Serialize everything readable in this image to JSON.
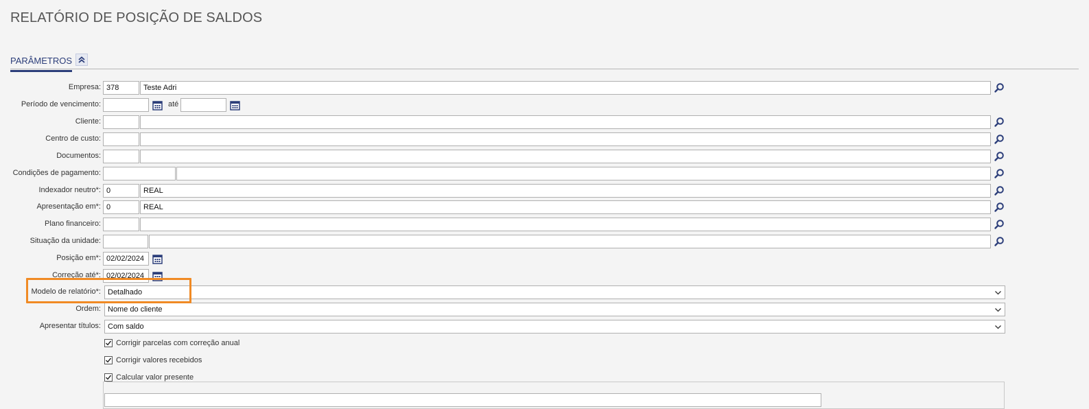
{
  "page": {
    "title": "RELATÓRIO DE POSIÇÃO DE SALDOS"
  },
  "section": {
    "title": "PARÂMETROS"
  },
  "fields": {
    "empresa": {
      "label": "Empresa:",
      "code": "378",
      "name": "Teste Adri"
    },
    "periodo": {
      "label": "Período de vencimento:",
      "from": "",
      "to": "",
      "ate_label": "até"
    },
    "cliente": {
      "label": "Cliente:",
      "code": "",
      "name": ""
    },
    "centro_custo": {
      "label": "Centro de custo:",
      "code": "",
      "name": ""
    },
    "documentos": {
      "label": "Documentos:",
      "code": "",
      "name": ""
    },
    "condicoes": {
      "label": "Condições de pagamento:",
      "code": "",
      "name": ""
    },
    "indexador": {
      "label": "Indexador neutro*:",
      "code": "0",
      "name": "REAL"
    },
    "apresentacao": {
      "label": "Apresentação em*:",
      "code": "0",
      "name": "REAL"
    },
    "plano": {
      "label": "Plano financeiro:",
      "code": "",
      "name": ""
    },
    "situacao": {
      "label": "Situação da unidade:",
      "code": "",
      "name": ""
    },
    "posicao": {
      "label": "Posição em*:",
      "value": "02/02/2024"
    },
    "correcao": {
      "label": "Correção até*:",
      "value": "02/02/2024"
    },
    "modelo": {
      "label": "Modelo de relatório*:",
      "value": "Detalhado"
    },
    "ordem": {
      "label": "Ordem:",
      "value": "Nome do cliente"
    },
    "apresentar": {
      "label": "Apresentar títulos:",
      "value": "Com saldo"
    }
  },
  "checkboxes": {
    "corrigir_parcelas": {
      "label": "Corrigir parcelas com correção anual",
      "checked": true
    },
    "corrigir_valores": {
      "label": "Corrigir valores recebidos",
      "checked": true
    },
    "calcular_vp": {
      "label": "Calcular valor presente",
      "checked": true
    }
  },
  "icons": {
    "search": "search-icon",
    "calendar": "calendar-icon",
    "chevron": "chevron-down-icon",
    "collapse": "double-chevron-up-icon"
  },
  "colors": {
    "accent": "#2c3e7a",
    "highlight": "#f08a24"
  }
}
